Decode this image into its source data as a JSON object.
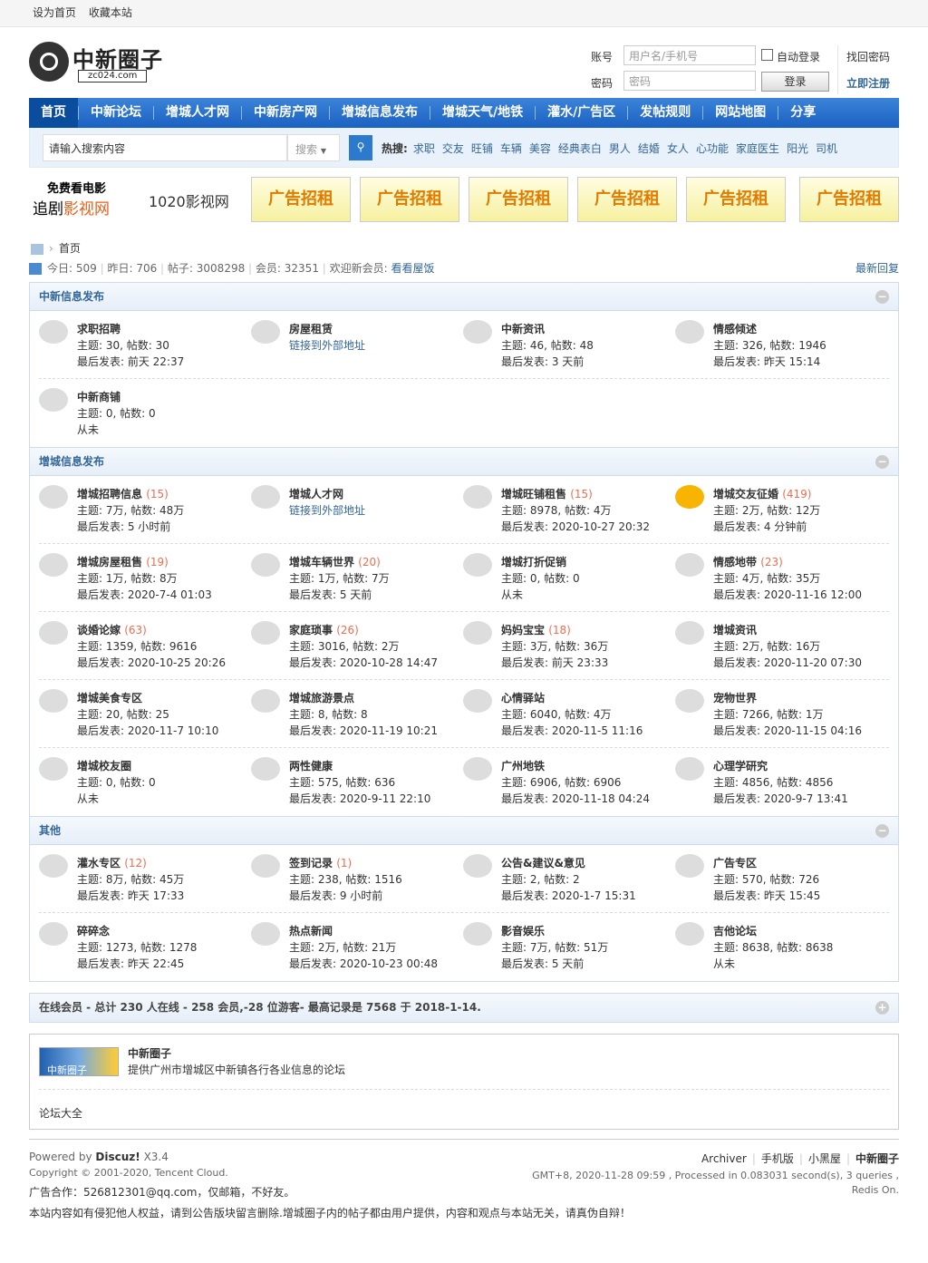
{
  "topbar": {
    "set_home": "设为首页",
    "bookmark": "收藏本站"
  },
  "logo": {
    "text": "中新圈子",
    "domain": "zc024.com"
  },
  "login": {
    "account_label": "账号",
    "account_placeholder": "用户名/手机号",
    "auto_login": "自动登录",
    "find_password": "找回密码",
    "password_label": "密码",
    "password_placeholder": "密码",
    "login_button": "登录",
    "register": "立即注册"
  },
  "nav": [
    "首页",
    "中新论坛",
    "增城人才网",
    "中新房产网",
    "增城信息发布",
    "增城天气/地铁",
    "灌水/广告区",
    "发帖规则",
    "网站地图",
    "分享"
  ],
  "search": {
    "placeholder": "请输入搜索内容",
    "type": "搜索",
    "hot_label": "热搜:",
    "hot": [
      "求职",
      "交友",
      "旺铺",
      "车辆",
      "美容",
      "经典表白",
      "男人",
      "结婚",
      "女人",
      "心功能",
      "家庭医生",
      "阳光",
      "司机"
    ]
  },
  "ads": {
    "brand_line1": "免费看电影",
    "brand_line2a": "追剧",
    "brand_line2b": "影视网",
    "brand2": "1020影视网",
    "ad_label": "广告招租"
  },
  "breadcrumb": {
    "home": "首页"
  },
  "stats": {
    "today_label": "今日:",
    "today": "509",
    "yesterday_label": "昨日:",
    "yesterday": "706",
    "posts_label": "帖子:",
    "posts": "3008298",
    "members_label": "会员:",
    "members": "32351",
    "welcome_label": "欢迎新会员:",
    "newest": "看看屋饭",
    "latest_reply": "最新回复"
  },
  "groups": [
    {
      "title": "中新信息发布",
      "rows": [
        [
          {
            "name": "求职招聘",
            "count": "",
            "l2": "主题: 30, 帖数: 30",
            "l3": "最后发表: 前天 22:37",
            "new": false,
            "link": false
          },
          {
            "name": "房屋租赁",
            "count": "",
            "l2": "链接到外部地址",
            "l3": "",
            "new": false,
            "link": true
          },
          {
            "name": "中新资讯",
            "count": "",
            "l2": "主题: 46, 帖数: 48",
            "l3": "最后发表: 3 天前",
            "new": false,
            "link": false
          },
          {
            "name": "情感倾述",
            "count": "",
            "l2": "主题: 326, 帖数: 1946",
            "l3": "最后发表: 昨天 15:14",
            "new": false,
            "link": false
          }
        ],
        [
          {
            "name": "中新商铺",
            "count": "",
            "l2": "主题: 0, 帖数: 0",
            "l3": "从未",
            "new": false,
            "link": false
          }
        ]
      ]
    },
    {
      "title": "增城信息发布",
      "rows": [
        [
          {
            "name": "增城招聘信息",
            "count": "(15)",
            "l2": "主题: 7万, 帖数: 48万",
            "l3": "最后发表: 5 小时前",
            "new": false,
            "link": false
          },
          {
            "name": "增城人才网",
            "count": "",
            "l2": "链接到外部地址",
            "l3": "",
            "new": false,
            "link": true
          },
          {
            "name": "增城旺铺租售",
            "count": "(15)",
            "l2": "主题: 8978, 帖数: 4万",
            "l3": "最后发表: 2020-10-27 20:32",
            "new": false,
            "link": false
          },
          {
            "name": "增城交友征婚",
            "count": "(419)",
            "l2": "主题: 2万, 帖数: 12万",
            "l3": "最后发表: 4 分钟前",
            "new": true,
            "link": false
          }
        ],
        [
          {
            "name": "增城房屋租售",
            "count": "(19)",
            "l2": "主题: 1万, 帖数: 8万",
            "l3": "最后发表: 2020-7-4 01:03",
            "new": false,
            "link": false
          },
          {
            "name": "增城车辆世界",
            "count": "(20)",
            "l2": "主题: 1万, 帖数: 7万",
            "l3": "最后发表: 5 天前",
            "new": false,
            "link": false
          },
          {
            "name": "增城打折促销",
            "count": "",
            "l2": "主题: 0, 帖数: 0",
            "l3": "从未",
            "new": false,
            "link": false
          },
          {
            "name": "情感地带",
            "count": "(23)",
            "l2": "主题: 4万, 帖数: 35万",
            "l3": "最后发表: 2020-11-16 12:00",
            "new": false,
            "link": false
          }
        ],
        [
          {
            "name": "谈婚论嫁",
            "count": "(63)",
            "l2": "主题: 1359, 帖数: 9616",
            "l3": "最后发表: 2020-10-25 20:26",
            "new": false,
            "link": false
          },
          {
            "name": "家庭琐事",
            "count": "(26)",
            "l2": "主题: 3016, 帖数: 2万",
            "l3": "最后发表: 2020-10-28 14:47",
            "new": false,
            "link": false
          },
          {
            "name": "妈妈宝宝",
            "count": "(18)",
            "l2": "主题: 3万, 帖数: 36万",
            "l3": "最后发表: 前天 23:33",
            "new": false,
            "link": false
          },
          {
            "name": "增城资讯",
            "count": "",
            "l2": "主题: 2万, 帖数: 16万",
            "l3": "最后发表: 2020-11-20 07:30",
            "new": false,
            "link": false
          }
        ],
        [
          {
            "name": "增城美食专区",
            "count": "",
            "l2": "主题: 20, 帖数: 25",
            "l3": "最后发表: 2020-11-7 10:10",
            "new": false,
            "link": false
          },
          {
            "name": "增城旅游景点",
            "count": "",
            "l2": "主题: 8, 帖数: 8",
            "l3": "最后发表: 2020-11-19 10:21",
            "new": false,
            "link": false
          },
          {
            "name": "心情驿站",
            "count": "",
            "l2": "主题: 6040, 帖数: 4万",
            "l3": "最后发表: 2020-11-5 11:16",
            "new": false,
            "link": false
          },
          {
            "name": "宠物世界",
            "count": "",
            "l2": "主题: 7266, 帖数: 1万",
            "l3": "最后发表: 2020-11-15 04:16",
            "new": false,
            "link": false
          }
        ],
        [
          {
            "name": "增城校友圈",
            "count": "",
            "l2": "主题: 0, 帖数: 0",
            "l3": "从未",
            "new": false,
            "link": false
          },
          {
            "name": "两性健康",
            "count": "",
            "l2": "主题: 575, 帖数: 636",
            "l3": "最后发表: 2020-9-11 22:10",
            "new": false,
            "link": false
          },
          {
            "name": "广州地铁",
            "count": "",
            "l2": "主题: 6906, 帖数: 6906",
            "l3": "最后发表: 2020-11-18 04:24",
            "new": false,
            "link": false
          },
          {
            "name": "心理学研究",
            "count": "",
            "l2": "主题: 4856, 帖数: 4856",
            "l3": "最后发表: 2020-9-7 13:41",
            "new": false,
            "link": false
          }
        ]
      ]
    },
    {
      "title": "其他",
      "rows": [
        [
          {
            "name": "灌水专区",
            "count": "(12)",
            "l2": "主题: 8万, 帖数: 45万",
            "l3": "最后发表: 昨天 17:33",
            "new": false,
            "link": false
          },
          {
            "name": "签到记录",
            "count": "(1)",
            "l2": "主题: 238, 帖数: 1516",
            "l3": "最后发表: 9 小时前",
            "new": false,
            "link": false
          },
          {
            "name": "公告&建议&意见",
            "count": "",
            "l2": "主题: 2, 帖数: 2",
            "l3": "最后发表: 2020-1-7 15:31",
            "new": false,
            "link": false
          },
          {
            "name": "广告专区",
            "count": "",
            "l2": "主题: 570, 帖数: 726",
            "l3": "最后发表: 昨天 15:45",
            "new": false,
            "link": false
          }
        ],
        [
          {
            "name": "碎碎念",
            "count": "",
            "l2": "主题: 1273, 帖数: 1278",
            "l3": "最后发表: 昨天 22:45",
            "new": false,
            "link": false
          },
          {
            "name": "热点新闻",
            "count": "",
            "l2": "主题: 2万, 帖数: 21万",
            "l3": "最后发表: 2020-10-23 00:48",
            "new": false,
            "link": false
          },
          {
            "name": "影音娱乐",
            "count": "",
            "l2": "主题: 7万, 帖数: 51万",
            "l3": "最后发表: 5 天前",
            "new": false,
            "link": false
          },
          {
            "name": "吉他论坛",
            "count": "",
            "l2": "主题: 8638, 帖数: 8638",
            "l3": "从未",
            "new": false,
            "link": false
          }
        ]
      ]
    }
  ],
  "online": {
    "text": "在线会员 - 总计 230 人在线 - 258 会员,-28 位游客- 最高记录是 7568 于 2018-1-14."
  },
  "friend_links": {
    "img_label": "中新圈子",
    "name": "中新圈子",
    "desc": "提供广州市增城区中新镇各行各业信息的论坛",
    "all": "论坛大全"
  },
  "footer": {
    "powered_label": "Powered by",
    "powered_name": "Discuz!",
    "version": "X3.4",
    "copyright": "Copyright © 2001-2020, Tencent Cloud.",
    "ad_contact": "广告合作：526812301@qq.com，仅邮箱，不好友。",
    "disclaimer": "本站内容如有侵犯他人权益，请到公告版块留言删除.增城圈子内的帖子都由用户提供，内容和观点与本站无关，请真伪自辩！",
    "links": [
      "Archiver",
      "手机版",
      "小黑屋",
      "中新圈子"
    ],
    "stats": "GMT+8, 2020-11-28 09:59 , Processed in 0.083031 second(s), 3 queries , Redis On."
  },
  "colors": {
    "nav": "#2a72cf",
    "link": "#336699",
    "count": "#f26c4f",
    "new_icon": "#f7b400"
  }
}
